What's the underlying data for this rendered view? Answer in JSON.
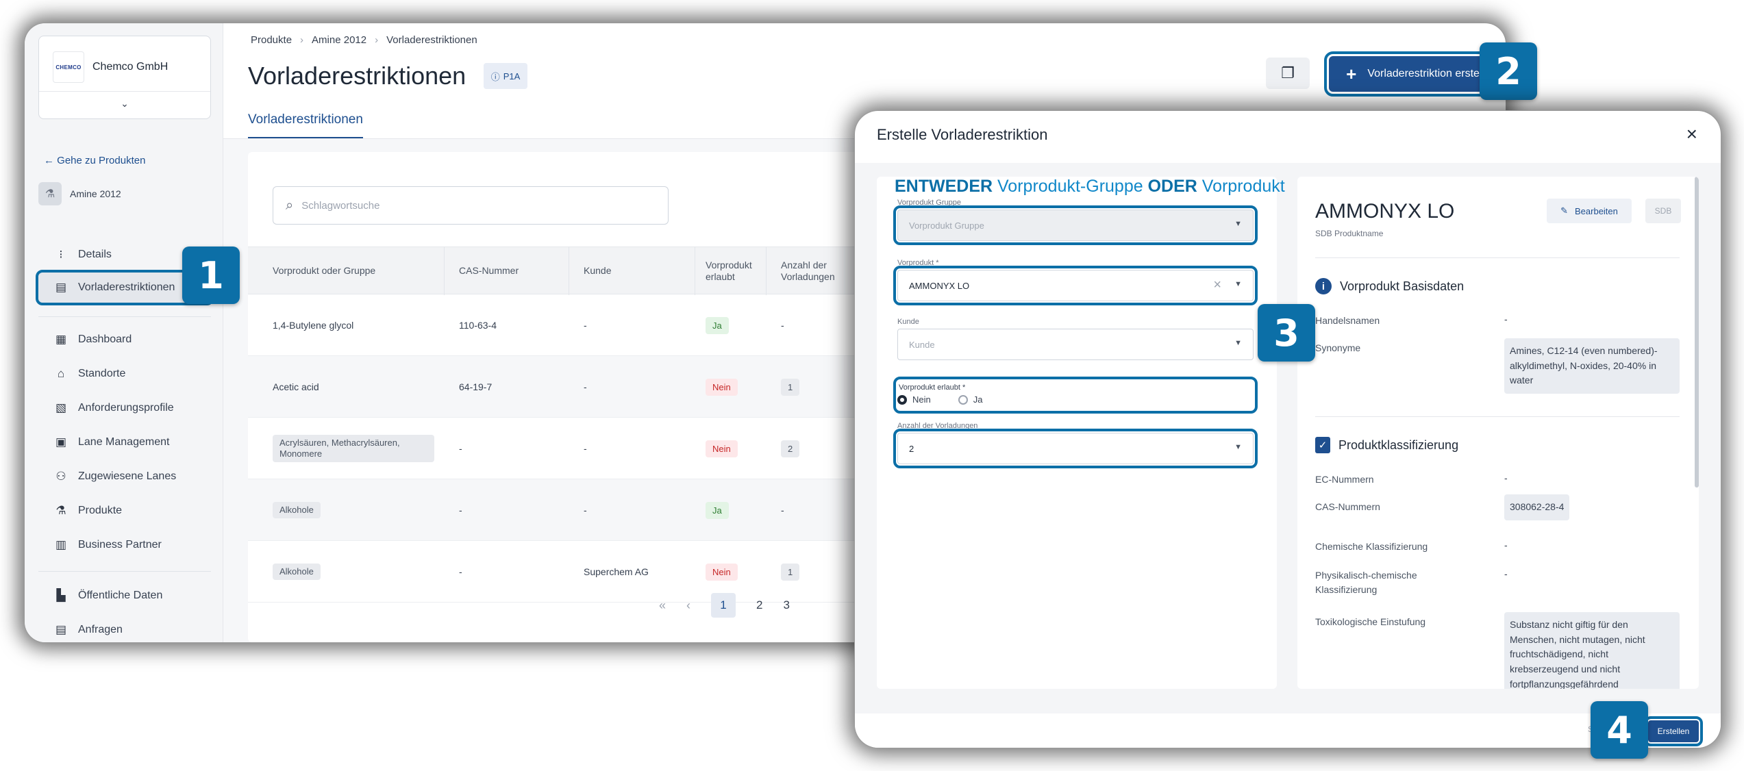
{
  "app": {
    "company": {
      "logo_text": "CHEMCO",
      "name": "Chemco GmbH"
    },
    "sidebar": {
      "back_link": "Gehe zu Produkten",
      "current_product": "Amine 2012",
      "items": [
        {
          "label": "Details",
          "icon": "details-icon"
        },
        {
          "label": "Vorladerestriktionen",
          "icon": "clipboard-icon"
        },
        {
          "label": "Dashboard",
          "icon": "dashboard-icon"
        },
        {
          "label": "Standorte",
          "icon": "building-icon"
        },
        {
          "label": "Anforderungsprofile",
          "icon": "document-icon"
        },
        {
          "label": "Lane Management",
          "icon": "lane-icon"
        },
        {
          "label": "Zugewiesene Lanes",
          "icon": "person-add-icon"
        },
        {
          "label": "Produkte",
          "icon": "flask-icon"
        },
        {
          "label": "Business Partner",
          "icon": "business-icon"
        },
        {
          "label": "Öffentliche Daten",
          "icon": "public-data-icon"
        },
        {
          "label": "Anfragen",
          "icon": "request-icon"
        }
      ]
    },
    "breadcrumb": [
      "Produkte",
      "Amine 2012",
      "Vorladerestriktionen"
    ],
    "page_title": "Vorladerestriktionen",
    "badge": "P1A",
    "tab": "Vorladerestriktionen",
    "search_placeholder": "Schlagwortsuche",
    "create_button": "Vorladerestriktion erstellen",
    "table": {
      "columns": [
        "Vorprodukt oder Gruppe",
        "CAS-Nummer",
        "Kunde",
        "Vorprodukt erlaubt",
        "Anzahl der Vorladungen"
      ],
      "rows": [
        {
          "name": "1,4-Butylene glycol",
          "cas": "110-63-4",
          "kunde": "-",
          "erlaubt": "Ja",
          "anzahl": "-"
        },
        {
          "name": "Acetic acid",
          "cas": "64-19-7",
          "kunde": "-",
          "erlaubt": "Nein",
          "anzahl": "1"
        },
        {
          "name": "Acrylsäuren, Methacrylsäuren, Monomere",
          "cas": "-",
          "kunde": "-",
          "erlaubt": "Nein",
          "anzahl": "2"
        },
        {
          "name": "Alkohole",
          "cas": "-",
          "kunde": "-",
          "erlaubt": "Ja",
          "anzahl": "-"
        },
        {
          "name": "Alkohole",
          "cas": "-",
          "kunde": "Superchem AG",
          "erlaubt": "Nein",
          "anzahl": "1"
        }
      ]
    },
    "pagination": {
      "first": "«",
      "prev": "‹",
      "pages": [
        "1",
        "2",
        "3"
      ],
      "current": "1"
    }
  },
  "steps": [
    "1",
    "2",
    "3",
    "4"
  ],
  "modal": {
    "title": "Erstelle Vorladerestriktion",
    "close": "×",
    "either_or": {
      "w1": "ENTWEDER",
      "t1": "Vorprodukt-Gruppe",
      "w2": "ODER",
      "t2": "Vorprodukt"
    },
    "fields": {
      "gruppe_label": "Vorprodukt Gruppe",
      "gruppe_placeholder": "Vorprodukt Gruppe",
      "vorprodukt_label": "Vorprodukt *",
      "vorprodukt_value": "AMMONYX LO",
      "kunde_label": "Kunde",
      "kunde_placeholder": "Kunde",
      "erlaubt_label": "Vorprodukt erlaubt *",
      "erlaubt_options": [
        "Nein",
        "Ja"
      ],
      "erlaubt_selected": "Nein",
      "anzahl_label": "Anzahl der Vorladungen",
      "anzahl_value": "2"
    },
    "detail": {
      "name": "AMMONYX LO",
      "subtitle": "SDB Produktname",
      "edit_button": "Bearbeiten",
      "sdb_button": "SDB",
      "section1": "Vorprodukt Basisdaten",
      "handelsnamen_label": "Handelsnamen",
      "handelsnamen_value": "-",
      "synonyme_label": "Synonyme",
      "synonyme_value": "Amines, C12-14 (even numbered)-alkyldimethyl, N-oxides, 20-40% in water",
      "section2": "Produktklassifizierung",
      "ec_label": "EC-Nummern",
      "ec_value": "-",
      "cas_label": "CAS-Nummern",
      "cas_value": "308062-28-4",
      "chem_label": "Chemische Klassifizierung",
      "chem_value": "-",
      "phys_label": "Physikalisch-chemische Klassifizierung",
      "phys_value": "-",
      "tox_label": "Toxikologische Einstufung",
      "tox_value": "Substanz nicht giftig für den Menschen, nicht mutagen, nicht fruchtschädigend, nicht krebserzeugend und nicht fortpflanzungsgefährdend"
    },
    "footer_hint": "S",
    "submit_button": "Erstellen"
  }
}
